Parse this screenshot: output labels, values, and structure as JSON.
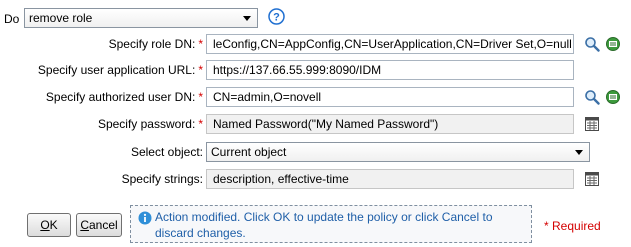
{
  "action": {
    "do_label": "Do",
    "selected": "remove role"
  },
  "fields": {
    "role_dn": {
      "label": "Specify role DN:",
      "value": "leConfig,CN=AppConfig,CN=UserApplication,CN=Driver Set,O=null"
    },
    "user_app_url": {
      "label": "Specify user application URL:",
      "value": "https://137.66.55.999:8090/IDM"
    },
    "auth_user_dn": {
      "label": "Specify authorized user DN:",
      "value": "CN=admin,O=novell"
    },
    "password": {
      "label": "Specify password:",
      "value": "Named Password(\"My Named Password\")"
    },
    "select_object": {
      "label": "Select object:",
      "value": "Current object"
    },
    "strings": {
      "label": "Specify strings:",
      "value": "description, effective-time"
    }
  },
  "required_marker": "*",
  "buttons": {
    "ok_accel": "O",
    "ok_rest": "K",
    "cancel_accel": "C",
    "cancel_rest": "ancel"
  },
  "message": {
    "line1": "Action modified. Click OK to update the policy or click Cancel to",
    "line2": "discard changes."
  },
  "required_note": "* Required",
  "colors": {
    "required_red": "#d40000",
    "help_blue": "#1f6fd1",
    "info_blue": "#2f8fd8",
    "message_text": "#1f5fa8"
  },
  "icons": {
    "help": "help-icon",
    "search": "search-icon",
    "browse": "browse-tree-icon",
    "editor": "editor-icon",
    "info": "info-icon"
  }
}
